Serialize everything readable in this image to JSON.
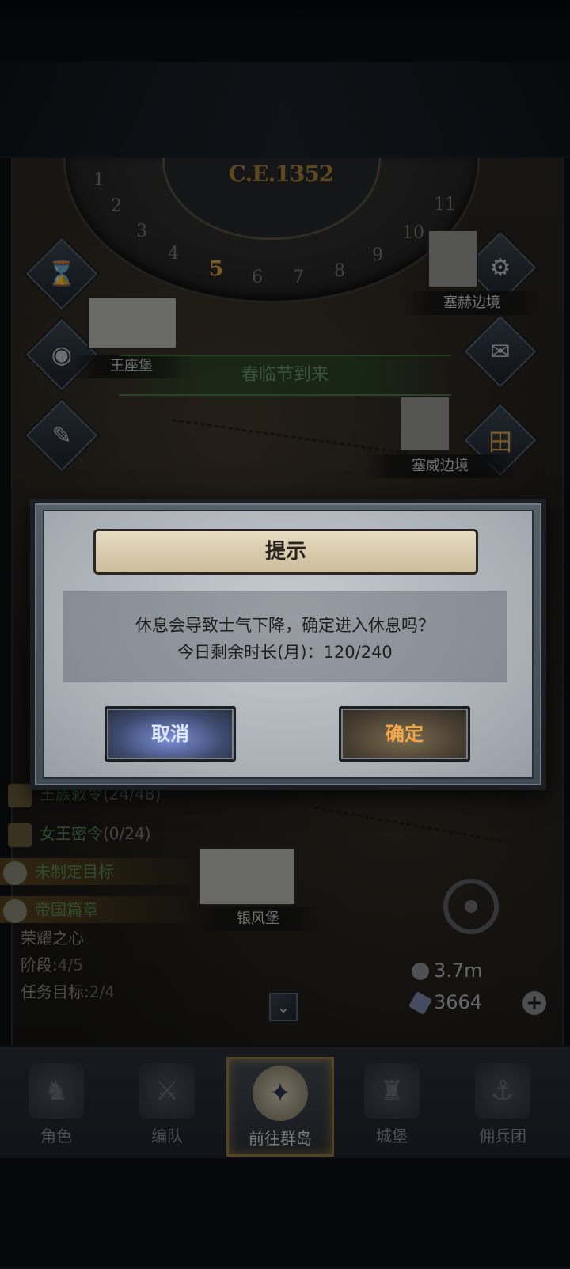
{
  "map": {
    "year": "C.E.1352",
    "months": [
      "1",
      "2",
      "3",
      "4",
      "5",
      "6",
      "7",
      "8",
      "9",
      "10",
      "11"
    ],
    "current_month": "5",
    "festival": "春临节到来",
    "locations": [
      "王座堡",
      "塞赫边境",
      "塞威边境",
      "银风堡"
    ]
  },
  "quests": [
    {
      "label": "王族敕令",
      "progress": "(24/48)"
    },
    {
      "label": "女王密令",
      "progress": "(0/24)"
    },
    {
      "label": "未制定目标",
      "progress": ""
    },
    {
      "label": "帝国篇章",
      "progress": ""
    }
  ],
  "chapter": {
    "name": "荣耀之心",
    "stage_label": "阶段:",
    "stage_value": "4/5",
    "goal_label": "任务目标:",
    "goal_value": "2/4"
  },
  "resources": {
    "silver": "3.7m",
    "gems": "3664"
  },
  "nav": [
    {
      "label": "角色"
    },
    {
      "label": "编队"
    },
    {
      "label": "前往群岛",
      "active": true
    },
    {
      "label": "城堡"
    },
    {
      "label": "佣兵团"
    }
  ],
  "dialog": {
    "title": "提示",
    "line1": "休息会导致士气下降，确定进入休息吗？",
    "line2": "今日剩余时长(月)：120/240",
    "cancel": "取消",
    "confirm": "确定"
  },
  "colors": {
    "accent_gold": "#e4a838",
    "quest_green": "#5a8a5a",
    "cancel_blue": "#7c8fd8",
    "confirm_orange": "#f2a54a"
  }
}
